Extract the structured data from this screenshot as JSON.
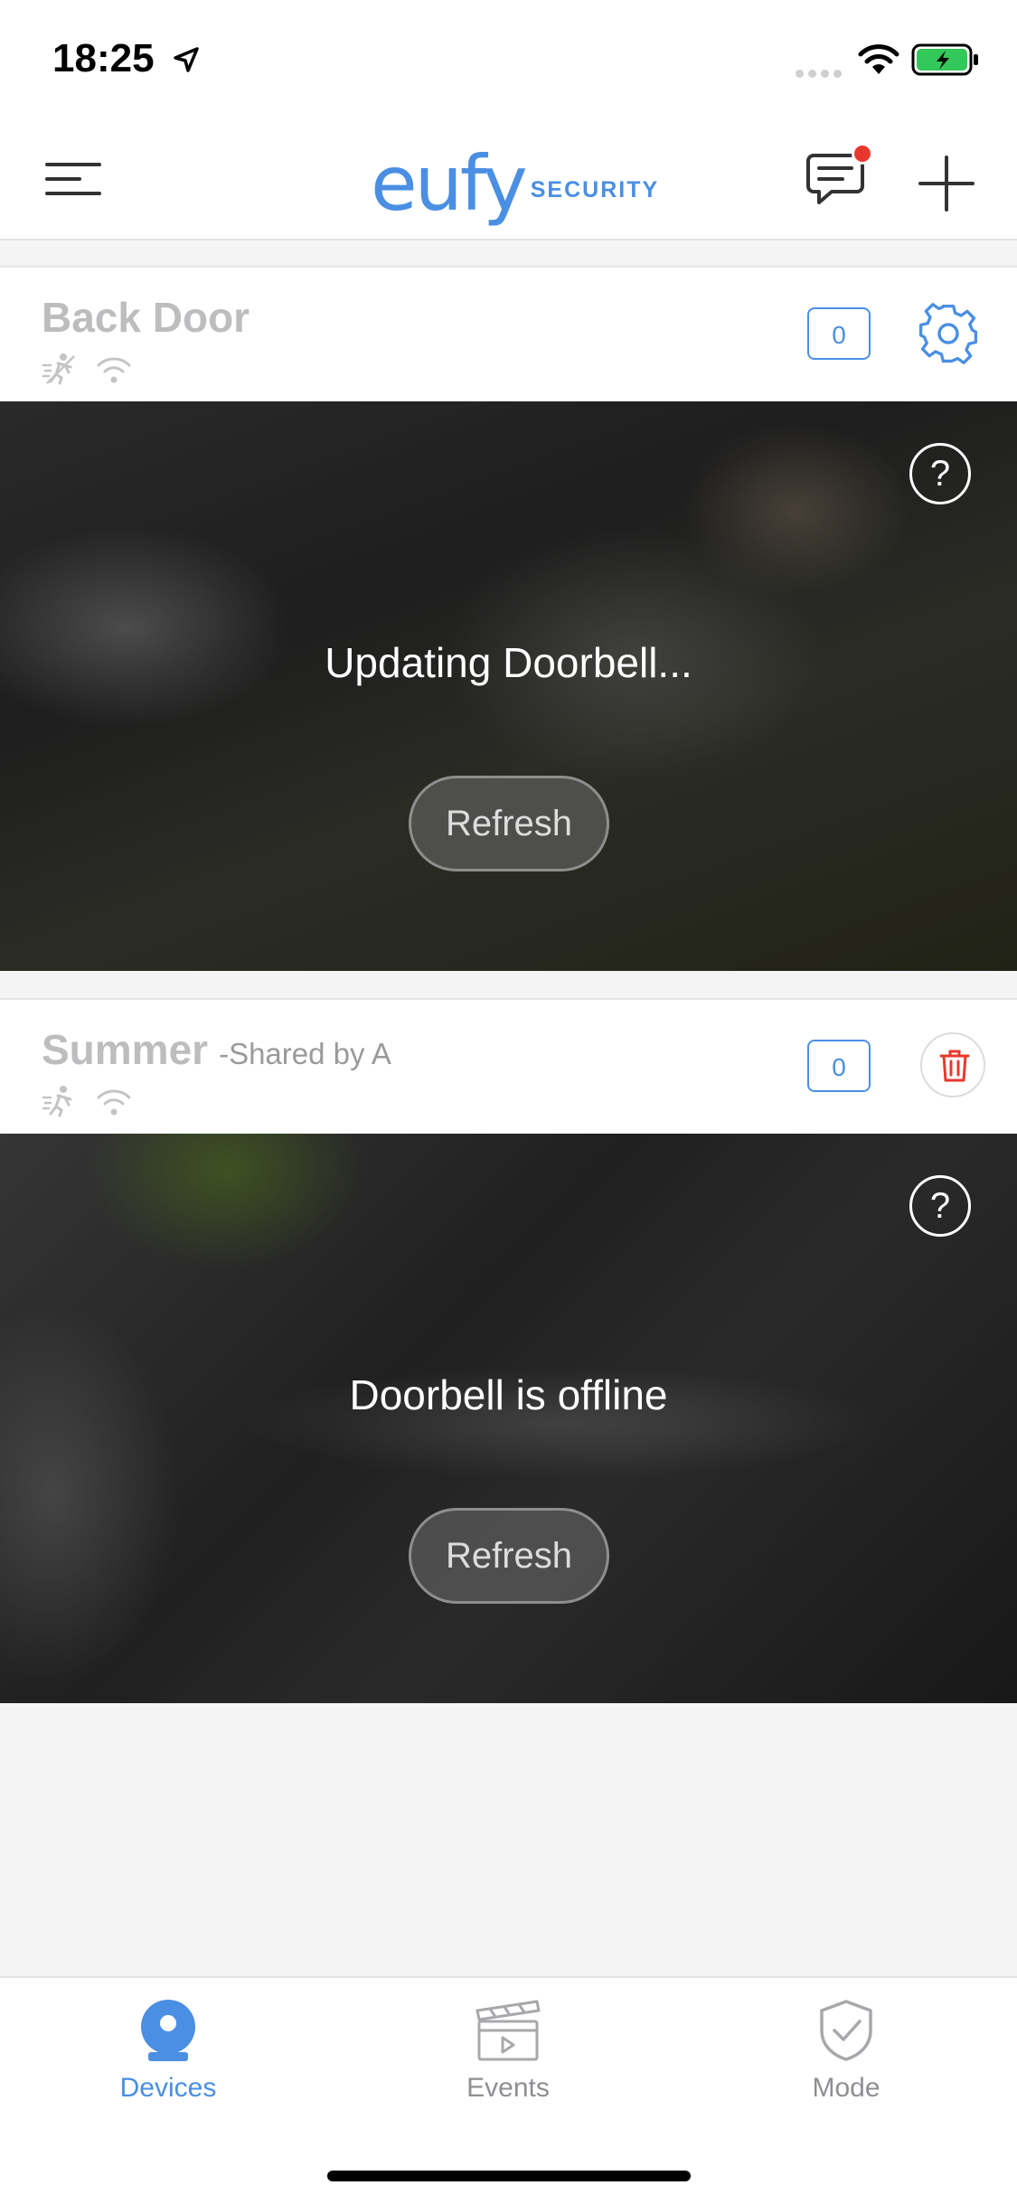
{
  "status_bar": {
    "time": "18:25"
  },
  "header": {
    "logo_word": "eufy",
    "logo_sub": "SECURITY",
    "brand_color": "#4a8fe3",
    "notification_color": "#e8382d"
  },
  "devices": [
    {
      "name": "Back Door",
      "shared_by": "",
      "event_count": "0",
      "feed_message": "Updating Doorbell...",
      "refresh_label": "Refresh",
      "help_label": "?",
      "action": "settings"
    },
    {
      "name": "Summer",
      "shared_by": "-Shared by A",
      "event_count": "0",
      "feed_message": "Doorbell is offline",
      "refresh_label": "Refresh",
      "help_label": "?",
      "action": "delete"
    }
  ],
  "tabs": [
    {
      "label": "Devices",
      "icon": "camera-icon",
      "active": true
    },
    {
      "label": "Events",
      "icon": "clapperboard-icon",
      "active": false
    },
    {
      "label": "Mode",
      "icon": "shield-check-icon",
      "active": false
    }
  ]
}
